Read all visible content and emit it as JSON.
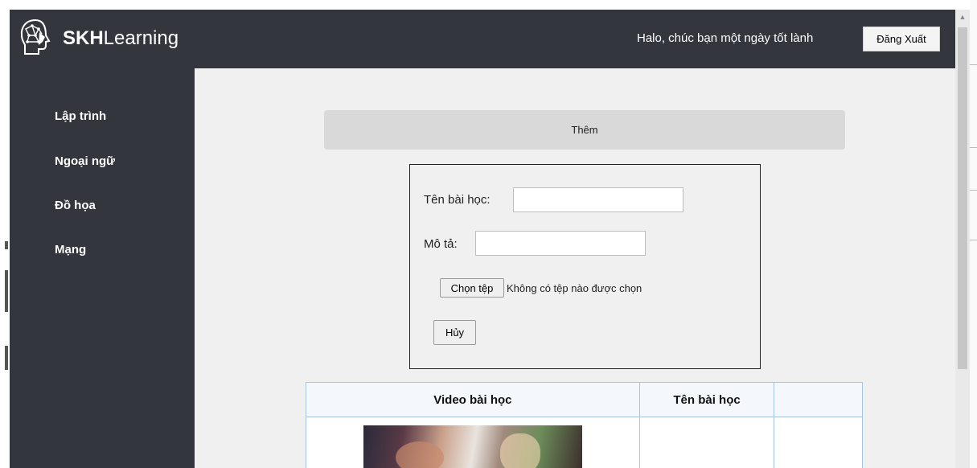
{
  "header": {
    "brand_bold": "SKH",
    "brand_light": "Learning",
    "greeting": "Halo, chúc bạn một ngày tốt lành",
    "logout_label": "Đăng Xuất"
  },
  "sidebar": {
    "items": [
      {
        "label": "Lập trình"
      },
      {
        "label": "Ngoại ngữ"
      },
      {
        "label": "Đồ họa"
      },
      {
        "label": "Mạng"
      }
    ]
  },
  "main": {
    "add_label": "Thêm",
    "form": {
      "lesson_name_label": "Tên bài học:",
      "lesson_name_value": "",
      "description_label": "Mô tả:",
      "description_value": "",
      "choose_file_label": "Chọn tệp",
      "no_file_text": "Không có tệp nào được chọn",
      "cancel_label": "Hủy"
    },
    "table": {
      "columns": [
        "Video bài học",
        "Tên bài học",
        ""
      ]
    }
  },
  "colors": {
    "header_bg": "#33363d",
    "content_bg": "#f0f0f0",
    "table_border": "#a8c4e0",
    "table_header_bg": "#f4f8fd"
  },
  "icons": {
    "logo": "brain-head-icon",
    "scroll_up": "triangle-up-icon"
  }
}
